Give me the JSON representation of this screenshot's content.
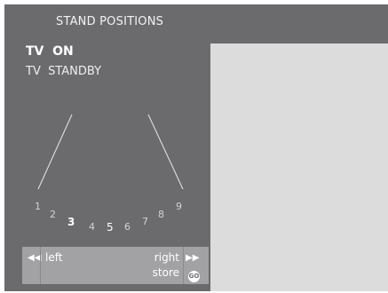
{
  "title": "STAND POSITIONS",
  "menu": {
    "items": [
      {
        "label": "TV  ON"
      },
      {
        "label": "TV  STANDBY"
      }
    ]
  },
  "positions": {
    "labels": [
      "1",
      "2",
      "3",
      "4",
      "5",
      "6",
      "7",
      "8",
      "9"
    ],
    "active": "3",
    "current": "5"
  },
  "nav": {
    "left_label": "left",
    "right_label": "right",
    "store_label": "store",
    "left_icon": "rewind-icon",
    "right_icon": "fast-forward-icon",
    "go_icon_text": "GO"
  },
  "colors": {
    "screen_background": "#6b6b6d",
    "preview_panel": "#dcdcdc",
    "nav_bar": "#a2a2a4"
  }
}
